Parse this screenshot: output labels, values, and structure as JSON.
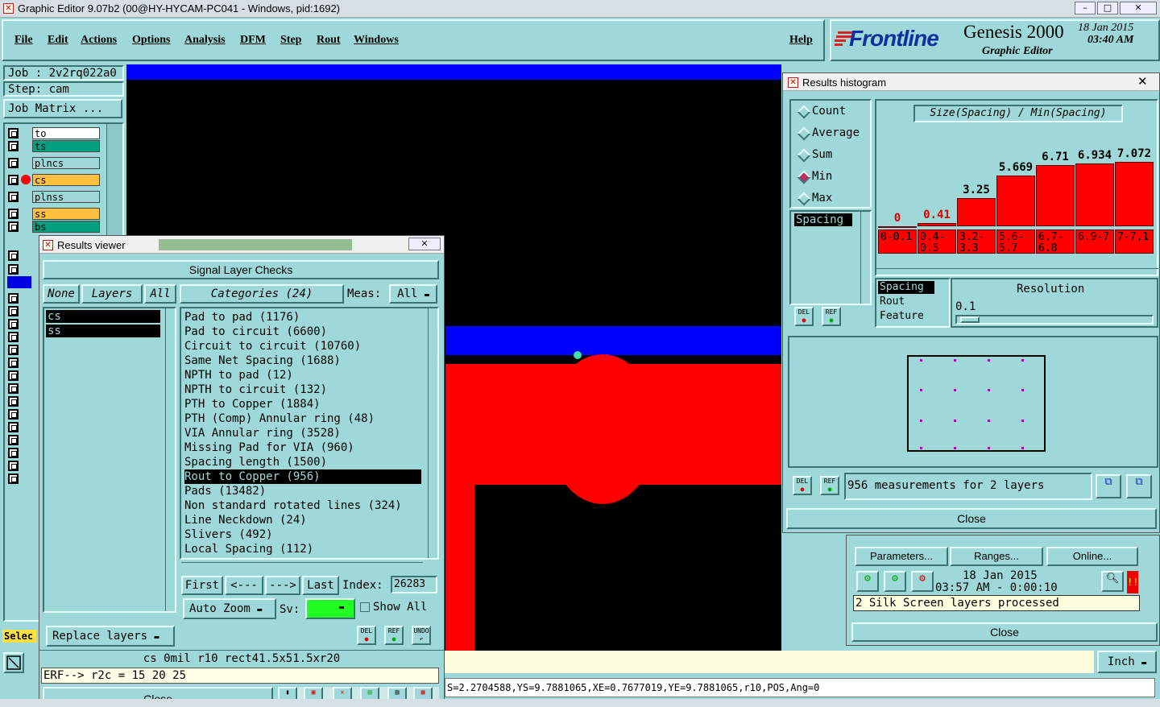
{
  "window": {
    "title": "Graphic Editor 9.07b2 (00@HY-HYCAM-PC041 - Windows, pid:1692)"
  },
  "menu": {
    "items": [
      "File",
      "Edit",
      "Actions",
      "Options",
      "Analysis",
      "DFM",
      "Step",
      "Rout",
      "Windows"
    ],
    "help": "Help"
  },
  "brand": {
    "logo": "Frontline",
    "product": "Genesis 2000",
    "subtitle": "Graphic Editor",
    "date": "18 Jan 2015",
    "time": "03:40 AM"
  },
  "left_panel": {
    "job_label": "Job : 2v2rq022a0",
    "step_label": "Step: cam",
    "job_matrix": "Job Matrix ...",
    "layers": [
      {
        "name": "to",
        "color": "#ffffff",
        "marker": ""
      },
      {
        "name": "ts",
        "color": "#00a080",
        "marker": ""
      },
      {
        "name": "plncs",
        "color": "#9ed8d8",
        "marker": ""
      },
      {
        "name": "cs",
        "color": "#ffc040",
        "marker": "red"
      },
      {
        "name": "plnss",
        "color": "#9ed8d8",
        "marker": ""
      },
      {
        "name": "ss",
        "color": "#ffc040",
        "marker": ""
      },
      {
        "name": "bs",
        "color": "#00a080",
        "marker": ""
      }
    ],
    "select_label": "Selec"
  },
  "results_viewer": {
    "title": "Results viewer",
    "header": "Signal Layer Checks",
    "none_btn": "None",
    "layers_btn": "Layers",
    "all_btn": "All",
    "categories_btn": "Categories (24)",
    "meas_label": "Meas:",
    "meas_value": "All",
    "layer_list": [
      "cs",
      "ss"
    ],
    "categories": [
      "Pad to pad (1176)",
      "Pad to circuit (6600)",
      "Circuit to circuit (10760)",
      "Same Net Spacing (1688)",
      "NPTH to pad (12)",
      "NPTH to circuit (132)",
      "PTH to Copper (1884)",
      "PTH (Comp) Annular ring (48)",
      "VIA Annular ring (3528)",
      "Missing Pad for VIA (960)",
      "Spacing length (1500)",
      "Rout to Copper (956)",
      "Pads (13482)",
      "Non standard rotated lines (324)",
      "Line Neckdown (24)",
      "Slivers (492)",
      "Local Spacing (112)"
    ],
    "selected_category": "Rout to Copper (956)",
    "nav": {
      "first": "First",
      "prev": "<---",
      "next": "--->",
      "last": "Last",
      "index_label": "Index:",
      "index_value": "26283"
    },
    "auto_zoom": "Auto Zoom",
    "sv_label": "Sv:",
    "show_all": "Show All",
    "replace_layers": "Replace layers",
    "del": "DEL",
    "ref": "REF",
    "undo": "UNDO",
    "info_line": "cs 0mil  r10  rect41.5x51.5xr20",
    "erf_line": "ERF--> r2c = 15 20 25",
    "close": "Close"
  },
  "histogram": {
    "title": "Results histogram",
    "modes": [
      "Count",
      "Average",
      "Sum",
      "Min",
      "Max"
    ],
    "selected_mode": "Min",
    "list_items": [
      "Spacing"
    ],
    "chart_title": "Size(Spacing) / Min(Spacing)",
    "bins": [
      {
        "range": "0-0.1",
        "min": 0
      },
      {
        "range": "0.4-0.5",
        "min": 0.41
      },
      {
        "range": "3.2-3.3",
        "min": 3.25
      },
      {
        "range": "5.6-5.7",
        "min": 5.669
      },
      {
        "range": "6.7-6.8",
        "min": 6.71
      },
      {
        "range": "6.9-7",
        "min": 6.934
      },
      {
        "range": "7-7.1",
        "min": 7.072
      }
    ],
    "resolution_items": [
      "Spacing",
      "Rout",
      "Feature"
    ],
    "resolution_label": "Resolution",
    "resolution_value": "0.1",
    "measurements": "956 measurements for 2 layers",
    "close": "Close"
  },
  "checklist": {
    "parameters": "Parameters...",
    "ranges": "Ranges...",
    "online": "Online...",
    "date": "18 Jan 2015",
    "time": "03:57 AM - 0:00:10",
    "status": "2 Silk Screen layers processed",
    "close": "Close"
  },
  "statusbar": {
    "units": "Inch",
    "coords": "S=2.2704588,YS=9.7881065,XE=0.7677019,YE=9.7881065,r10,POS,Ang=0"
  }
}
